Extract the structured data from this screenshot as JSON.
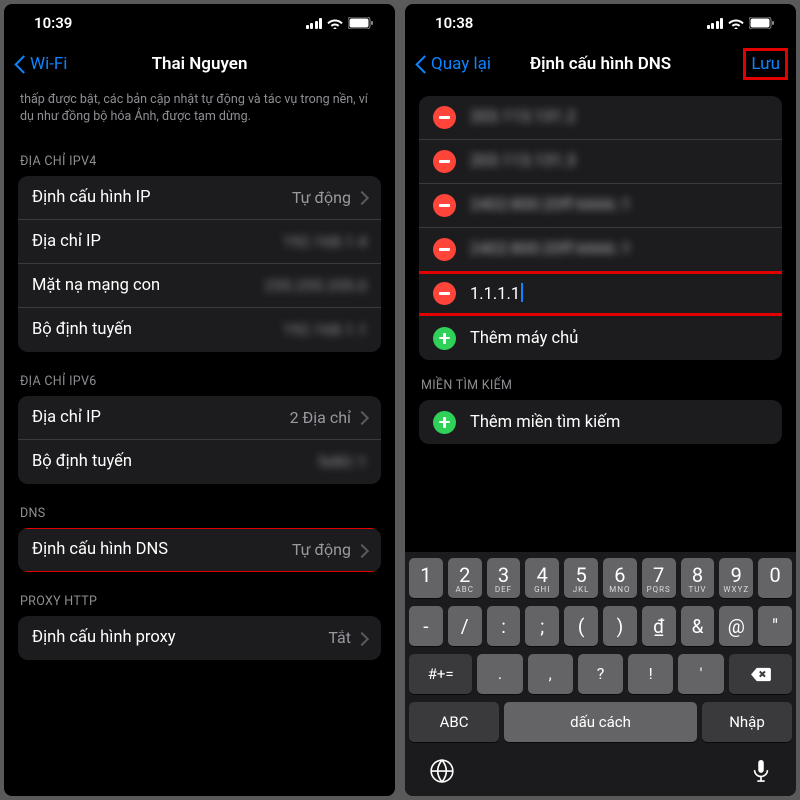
{
  "left": {
    "time": "10:39",
    "back": "Wi-Fi",
    "title": "Thai Nguyen",
    "desc": "thấp được bật, các bản cập nhật tự động và tác vụ trong nền, ví dụ như đồng bộ hóa Ảnh, được tạm dừng.",
    "ipv4Header": "ĐỊA CHỈ IPV4",
    "ipv4": {
      "configIp": "Định cấu hình IP",
      "configIpValue": "Tự động",
      "ip": "Địa chỉ IP",
      "ipValue": "192.168.1.4",
      "subnet": "Mặt nạ mạng con",
      "subnetValue": "255.255.255.0",
      "router": "Bộ định tuyến",
      "routerValue": "192.168.1.1"
    },
    "ipv6Header": "ĐỊA CHỈ IPV6",
    "ipv6": {
      "ip": "Địa chỉ IP",
      "ipValue": "2 Địa chỉ",
      "router": "Bộ định tuyến",
      "routerValue": "fe80::1"
    },
    "dnsHeader": "DNS",
    "dns": {
      "label": "Định cấu hình DNS",
      "value": "Tự động"
    },
    "proxyHeader": "PROXY HTTP",
    "proxy": {
      "label": "Định cấu hình proxy",
      "value": "Tắt"
    }
  },
  "right": {
    "time": "10:38",
    "back": "Quay lại",
    "title": "Định cấu hình DNS",
    "save": "Lưu",
    "servers": [
      "203.113.131.2",
      "203.113.131.3",
      "2402:800:20ff:6666::1",
      "2402:800:20ff:6666::1"
    ],
    "entry": "1.1.1.1",
    "addServer": "Thêm máy chủ",
    "searchHeader": "MIỀN TÌM KIẾM",
    "addSearch": "Thêm miền tìm kiếm",
    "kb": {
      "abc": "ABC",
      "space": "dấu cách",
      "enter": "Nhập",
      "sym": "#+="
    }
  }
}
